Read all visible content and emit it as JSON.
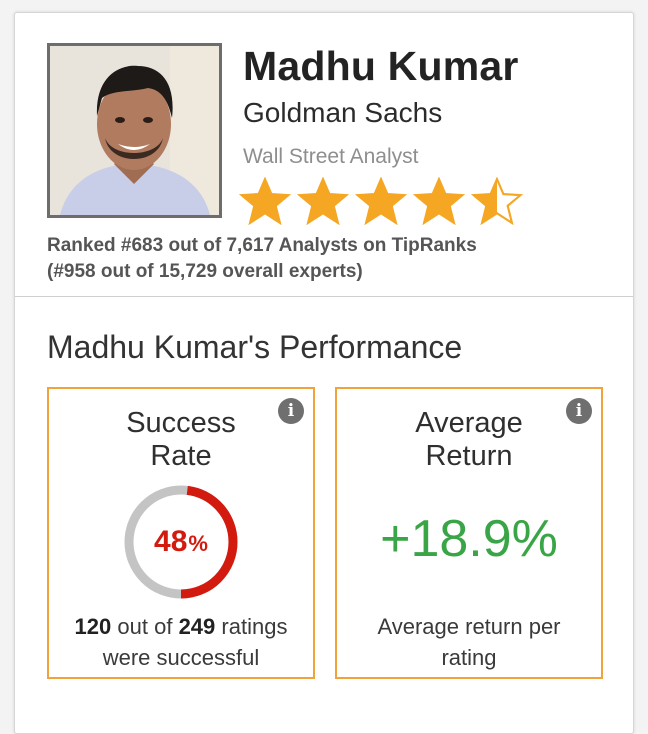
{
  "profile": {
    "name": "Madhu Kumar",
    "firm": "Goldman Sachs",
    "role": "Wall Street Analyst",
    "rating_stars": 4.5,
    "rank_line1": "Ranked #683 out of 7,617 Analysts on TipRanks",
    "rank_line2": "(#958 out of 15,729 overall experts)"
  },
  "performance": {
    "title": "Madhu Kumar's Performance",
    "success_rate": {
      "title_line1": "Success",
      "title_line2": "Rate",
      "percent_number": "48",
      "percent_sign": "%",
      "fraction": 0.48,
      "successful": "120",
      "out_of_text": "out of",
      "total": "249",
      "ratings_text": "ratings",
      "foot_line2": "were successful",
      "info_icon": "i"
    },
    "average_return": {
      "title_line1": "Average",
      "title_line2": "Return",
      "value": "+18.9%",
      "foot_line1": "Average return per",
      "foot_line2": "rating",
      "info_icon": "i"
    }
  },
  "colors": {
    "accent_orange": "#f2a23a",
    "star": "#f5a623",
    "success_red": "#d21a0f",
    "donut_track": "#c4c4c4",
    "return_green": "#3aa546"
  }
}
